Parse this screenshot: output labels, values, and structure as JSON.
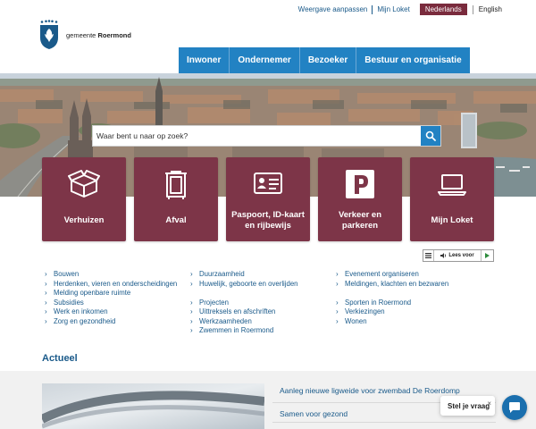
{
  "header": {
    "logo_prefix": "gemeente",
    "logo_name": "Roermond",
    "top_links": [
      "Weergave aanpassen",
      "Mijn Loket"
    ],
    "languages": [
      "Nederlands",
      "English"
    ],
    "active_language": "Nederlands"
  },
  "nav": {
    "items": [
      "Inwoner",
      "Ondernemer",
      "Bezoeker",
      "Bestuur en organisatie"
    ]
  },
  "search": {
    "placeholder": "Waar bent u naar op zoek?"
  },
  "tiles": [
    {
      "label": "Verhuizen",
      "icon": "moving-box-icon"
    },
    {
      "label": "Afval",
      "icon": "waste-container-icon"
    },
    {
      "label": "Paspoort, ID-kaart en rijbewijs",
      "icon": "id-card-icon"
    },
    {
      "label": "Verkeer en parkeren",
      "icon": "parking-icon"
    },
    {
      "label": "Mijn Loket",
      "icon": "laptop-icon"
    }
  ],
  "read_aloud": {
    "label": "Lees voor"
  },
  "links": {
    "col1": [
      "Bouwen",
      "Herdenken, vieren en onderscheidingen",
      "Melding openbare ruimte",
      "Subsidies",
      "Werk en inkomen",
      "Zorg en gezondheid"
    ],
    "col2": [
      "Duurzaamheid",
      "Huwelijk, geboorte en overlijden",
      "Projecten",
      "Uittreksels en afschriften",
      "Werkzaamheden",
      "Zwemmen in Roermond"
    ],
    "col3": [
      "Evenement organiseren",
      "Meldingen, klachten en bezwaren",
      "Sporten in Roermond",
      "Verkiezingen",
      "Wonen"
    ]
  },
  "actueel": {
    "title": "Actueel",
    "news": [
      "Aanleg nieuwe ligweide voor zwembad De Roerdomp",
      "Samen voor gezond"
    ]
  },
  "chat": {
    "label": "Stel je vraag",
    "close": "×"
  },
  "colors": {
    "brand_blue": "#2282c3",
    "tile_burgundy": "#7d3548",
    "link_blue": "#1a5a8a",
    "lang_active": "#7a2b3d"
  }
}
